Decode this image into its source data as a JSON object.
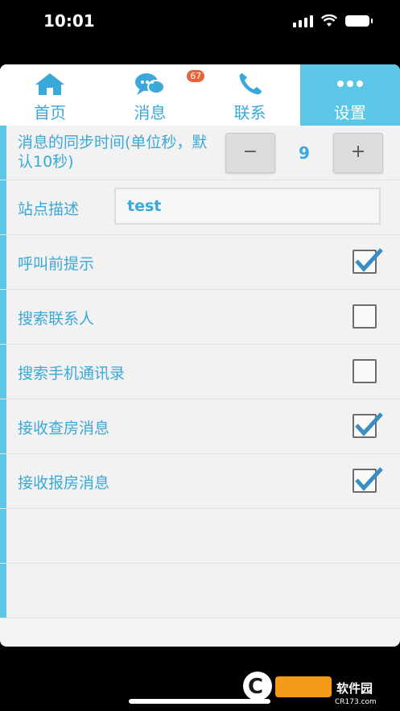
{
  "status": {
    "time": "10:01"
  },
  "tabs": [
    {
      "label": "首页",
      "icon": "home-icon"
    },
    {
      "label": "消息",
      "icon": "chat-icon",
      "badge": "67"
    },
    {
      "label": "联系",
      "icon": "phone-icon"
    },
    {
      "label": "设置",
      "icon": "more-icon",
      "active": true
    }
  ],
  "settings": {
    "sync": {
      "label": "消息的同步时间(单位秒，默认10秒)",
      "minus": "−",
      "plus": "+",
      "value": "9"
    },
    "site": {
      "label": "站点描述",
      "value": "test"
    },
    "items": [
      {
        "label": "呼叫前提示",
        "checked": true
      },
      {
        "label": "搜索联系人",
        "checked": false
      },
      {
        "label": "搜索手机通讯录",
        "checked": false
      },
      {
        "label": "接收查房消息",
        "checked": true
      },
      {
        "label": "接收报房消息",
        "checked": true
      }
    ]
  },
  "watermark": "CR173.com"
}
